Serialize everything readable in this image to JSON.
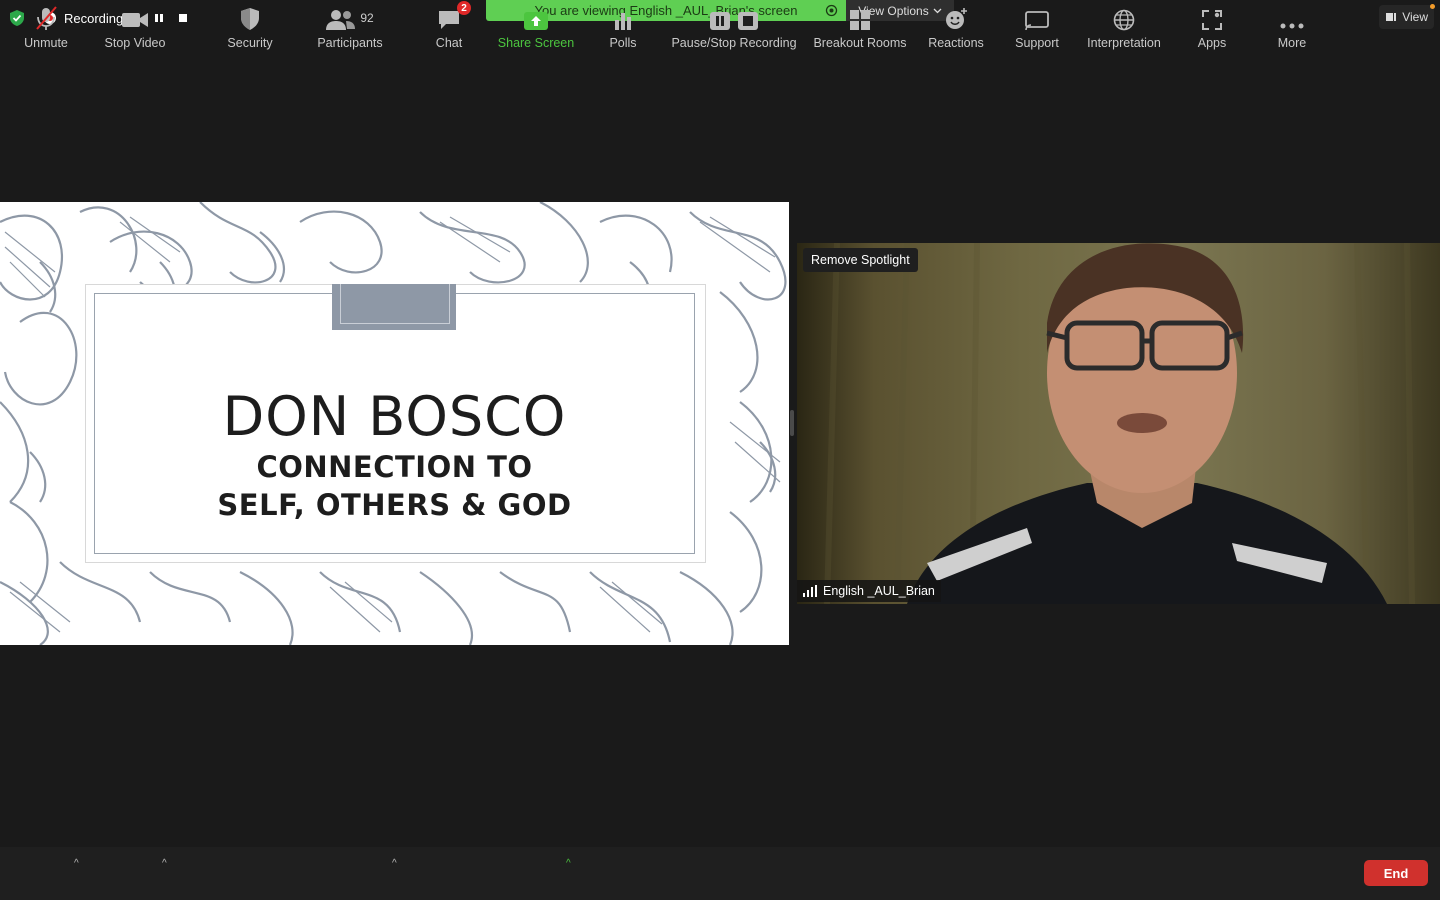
{
  "status": {
    "recording_label": "Recording...",
    "viewing_banner": "You are viewing English _AUL_Brian's screen",
    "view_options_label": "View Options",
    "view_label": "View"
  },
  "slide": {
    "title": "DON BOSCO",
    "subtitle_line1": "CONNECTION TO",
    "subtitle_line2": "SELF, OTHERS & GOD"
  },
  "video": {
    "spotlight_button": "Remove Spotlight",
    "participant_name": "English _AUL_Brian"
  },
  "toolbar": {
    "unmute": "Unmute",
    "stop_video": "Stop Video",
    "security": "Security",
    "participants": "Participants",
    "participants_count": "92",
    "chat": "Chat",
    "chat_badge": "2",
    "share_screen": "Share Screen",
    "polls": "Polls",
    "pause_stop_recording": "Pause/Stop Recording",
    "breakout_rooms": "Breakout Rooms",
    "reactions": "Reactions",
    "support": "Support",
    "interpretation": "Interpretation",
    "apps": "Apps",
    "more": "More",
    "end": "End"
  },
  "colors": {
    "banner_green": "#5fcf53",
    "end_red": "#d0312d",
    "share_green": "#4cc53f",
    "pattern_ink": "#8e98a6"
  }
}
